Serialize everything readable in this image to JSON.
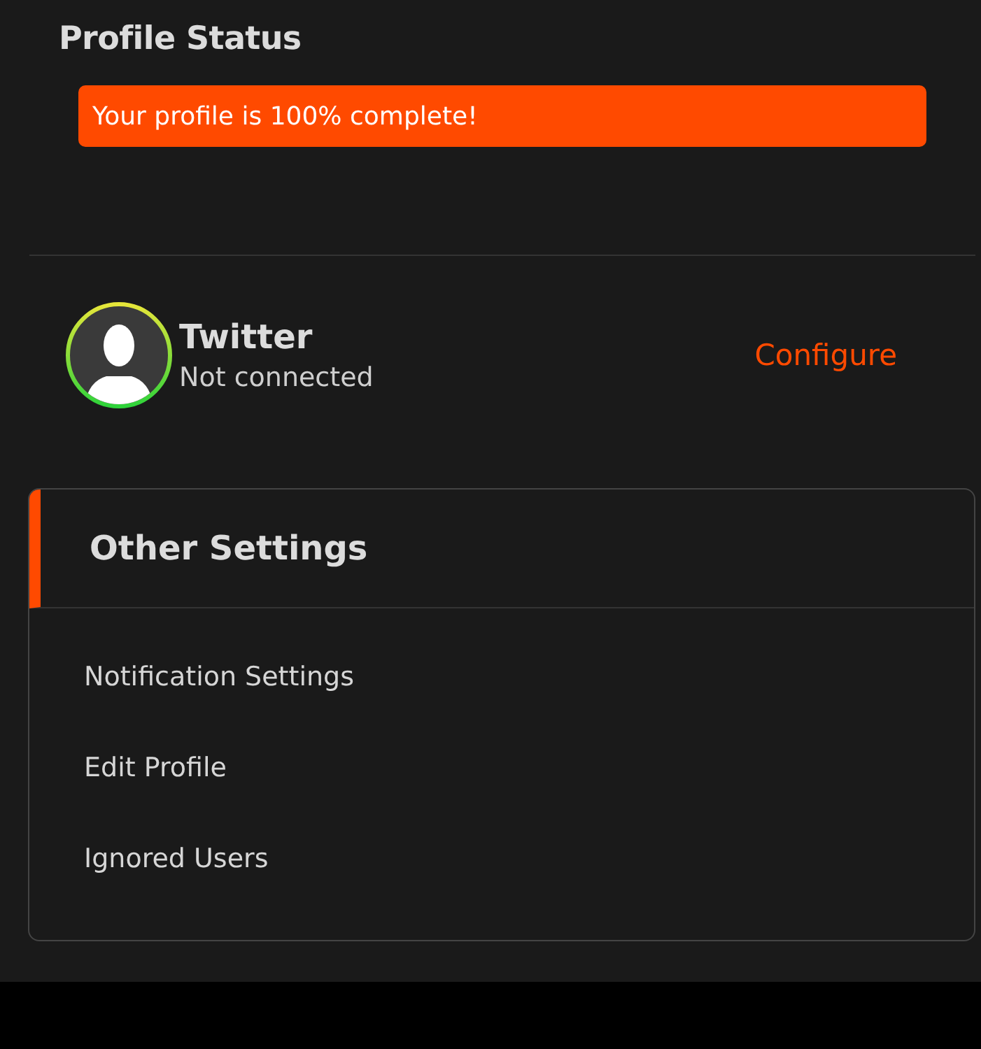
{
  "profile_status": {
    "title": "Profile Status",
    "banner": "Your profile is 100% complete!"
  },
  "connection": {
    "service": "Twitter",
    "status": "Not connected",
    "action": "Configure"
  },
  "other_settings": {
    "title": "Other Settings",
    "items": [
      "Notification Settings",
      "Edit Profile",
      "Ignored Users"
    ]
  }
}
